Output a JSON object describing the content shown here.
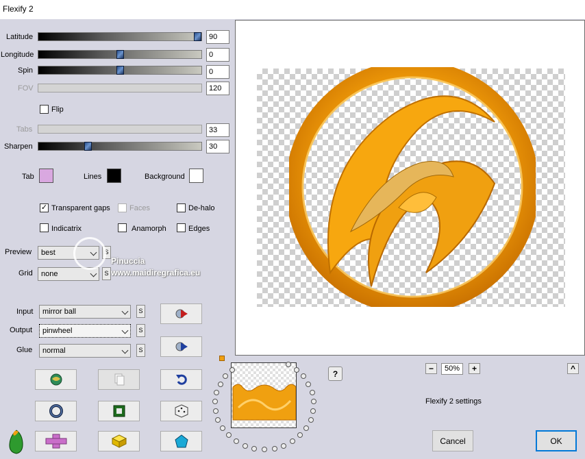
{
  "window": {
    "title": "Flexify 2"
  },
  "controls": {
    "latitude": {
      "label": "Latitude",
      "value": "90",
      "level_fraction": 1.0
    },
    "longitude": {
      "label": "Longitude",
      "value": "0",
      "level_fraction": 0.5
    },
    "spin": {
      "label": "Spin",
      "value": "0",
      "level_fraction": 0.5
    },
    "fov": {
      "label": "FOV",
      "value": "120"
    },
    "flip": {
      "label": "Flip",
      "checked": false
    },
    "tabs": {
      "label": "Tabs",
      "value": "33"
    },
    "sharpen": {
      "label": "Sharpen",
      "value": "30",
      "level_fraction": 0.3
    }
  },
  "colors": {
    "tab": {
      "label": "Tab",
      "color": "#d9a8e0"
    },
    "lines": {
      "label": "Lines",
      "color": "#000000"
    },
    "background": {
      "label": "Background",
      "color": "#ffffff"
    }
  },
  "options": {
    "transparent_gaps": {
      "label": "Transparent gaps",
      "checked": true,
      "check_glyph": "✓"
    },
    "faces": {
      "label": "Faces",
      "checked": false
    },
    "de_halo": {
      "label": "De-halo",
      "checked": false
    },
    "indicatrix": {
      "label": "Indicatrix",
      "checked": false
    },
    "anamorph": {
      "label": "Anamorph",
      "checked": false
    },
    "edges": {
      "label": "Edges",
      "checked": false
    }
  },
  "dropdowns": {
    "preview": {
      "label": "Preview",
      "value": "best"
    },
    "grid": {
      "label": "Grid",
      "value": "none"
    },
    "input": {
      "label": "Input",
      "value": "mirror ball"
    },
    "output": {
      "label": "Output",
      "value": "pinwheel"
    },
    "glue": {
      "label": "Glue",
      "value": "normal"
    },
    "s_label": "S"
  },
  "watermark": {
    "line1": "Pinuccia",
    "line2": "www.maidiregrafica.eu"
  },
  "zoom": {
    "minus": "−",
    "value": "50%",
    "plus": "+"
  },
  "help_label": "?",
  "collapse_label": "^",
  "settings_label": "Flexify 2 settings",
  "buttons": {
    "cancel": "Cancel",
    "ok": "OK"
  },
  "icons": {
    "tool_buttons": [
      "globe-icon",
      "copy-icon",
      "undo-icon",
      "ring-icon",
      "frame-icon",
      "dice-icon",
      "cross-icon",
      "cube-icon",
      "pentagon-icon"
    ],
    "play_forward": "play-forward-icon",
    "play_back": "play-back-icon",
    "logo": "flaming-pear-logo-icon"
  },
  "accent_color": "#f0a010"
}
